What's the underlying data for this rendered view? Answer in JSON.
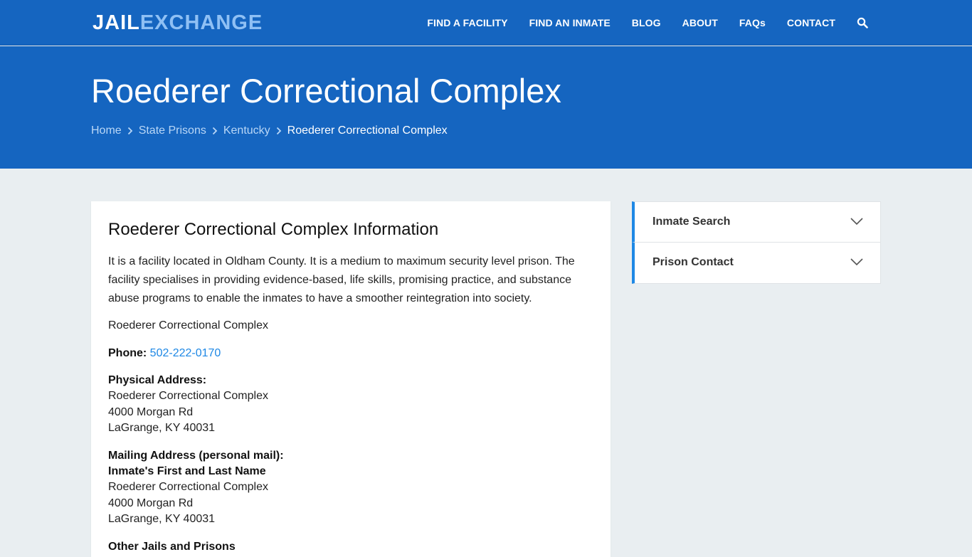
{
  "brand": {
    "part1": "JAIL",
    "part2": "EXCHANGE"
  },
  "nav": {
    "items": [
      "FIND A FACILITY",
      "FIND AN INMATE",
      "BLOG",
      "ABOUT",
      "FAQs",
      "CONTACT"
    ],
    "search_icon": "search-icon"
  },
  "hero": {
    "title": "Roederer Correctional Complex",
    "breadcrumb": [
      "Home",
      "State Prisons",
      "Kentucky",
      "Roederer Correctional Complex"
    ]
  },
  "main": {
    "heading": "Roederer Correctional Complex Information",
    "intro": "It is a facility located in Oldham County. It is a medium to maximum security level prison. The facility specialises in providing evidence-based, life skills, promising practice, and substance abuse programs to enable the inmates to have a smoother reintegration into society.",
    "facility_name": "Roederer Correctional Complex",
    "phone_label": "Phone:",
    "phone": "502-222-0170",
    "physical_label": "Physical Address:",
    "physical": [
      "Roederer Correctional Complex",
      "4000 Morgan Rd",
      "LaGrange, KY 40031"
    ],
    "mailing_label": "Mailing Address (personal mail):",
    "mailing_name": "Inmate's First and Last Name",
    "mailing": [
      "Roederer Correctional Complex",
      "4000 Morgan Rd",
      "LaGrange, KY 40031"
    ],
    "other_label": "Other Jails and Prisons"
  },
  "sidebar": {
    "items": [
      {
        "label": "Inmate Search",
        "icon": "chevron-down-icon"
      },
      {
        "label": "Prison Contact",
        "icon": "chevron-down-icon"
      }
    ]
  },
  "colors": {
    "primary": "#1565c0",
    "accent": "#1e88e5",
    "logo_light": "#8fc0f4",
    "page_bg": "#e9eef1"
  }
}
